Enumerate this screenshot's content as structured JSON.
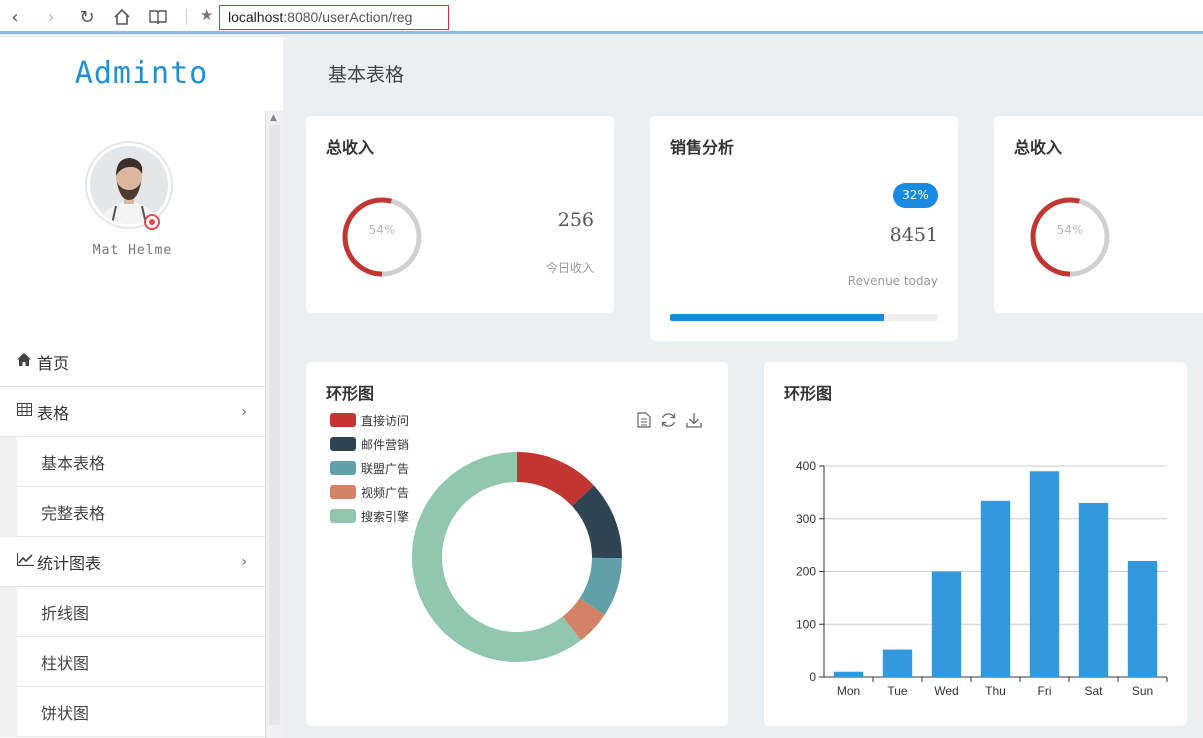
{
  "browser": {
    "url_host": "localhost",
    "url_rest": ":8080/userAction/reg"
  },
  "sidebar": {
    "brand": "Adminto",
    "user_name": "Mat Helme",
    "menu": [
      {
        "label": "首页",
        "icon": "home-icon",
        "has_chevron": false
      },
      {
        "label": "表格",
        "icon": "table-icon",
        "has_chevron": true,
        "children": [
          "基本表格",
          "完整表格"
        ]
      },
      {
        "label": "统计图表",
        "icon": "line-chart-icon",
        "has_chevron": true,
        "children": [
          "折线图",
          "柱状图",
          "饼状图"
        ]
      }
    ]
  },
  "page": {
    "title": "基本表格"
  },
  "cards": {
    "income": {
      "title": "总收入",
      "percent_label": "54%",
      "percent": 54,
      "value": "256",
      "caption": "今日收入"
    },
    "sales": {
      "title": "销售分析",
      "badge": "32%",
      "value": "8451",
      "caption": "Revenue today",
      "progress": 80
    },
    "income2": {
      "title": "总收入",
      "percent_label": "54%",
      "percent": 54
    }
  },
  "colors": {
    "accent": "#188ae2",
    "donut_red": "#c23531",
    "donut_gray": "#d0d0d0",
    "bar_blue": "#3398db"
  },
  "pie_card": {
    "title": "环形图",
    "toolbar_icons": [
      "data-view-icon",
      "refresh-icon",
      "download-icon"
    ]
  },
  "bar_card": {
    "title": "环形图"
  },
  "chart_data": [
    {
      "type": "pie",
      "variant": "doughnut",
      "legend_position": "top-left",
      "categories": [
        "直接访问",
        "邮件营销",
        "联盟广告",
        "视频广告",
        "搜索引擎"
      ],
      "values": [
        335,
        310,
        234,
        135,
        1548
      ],
      "colors": [
        "#c23531",
        "#2f4554",
        "#61a0a8",
        "#d48265",
        "#91c7ae"
      ]
    },
    {
      "type": "bar",
      "categories": [
        "Mon",
        "Tue",
        "Wed",
        "Thu",
        "Fri",
        "Sat",
        "Sun"
      ],
      "values": [
        10,
        52,
        200,
        334,
        390,
        330,
        220
      ],
      "ylim": [
        0,
        400
      ],
      "yticks": [
        0,
        100,
        200,
        300,
        400
      ],
      "grid": true,
      "color": "#3398db"
    }
  ]
}
